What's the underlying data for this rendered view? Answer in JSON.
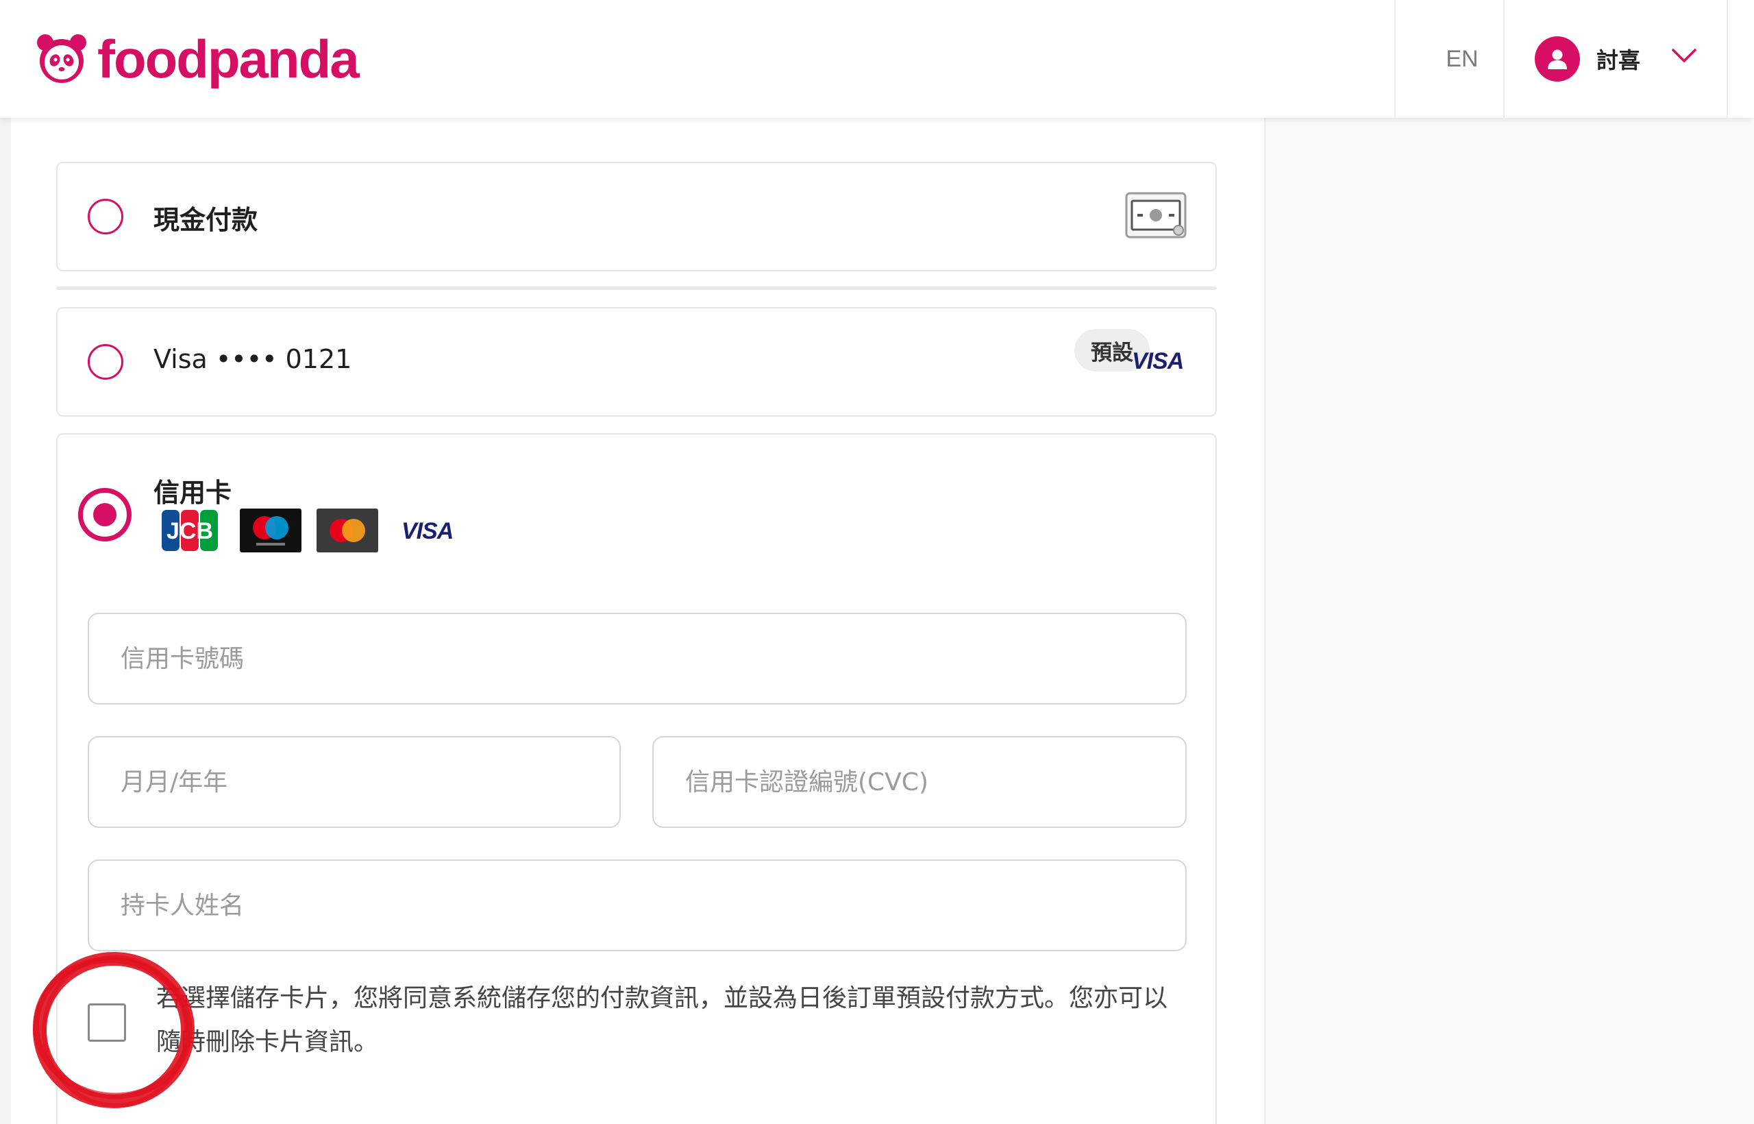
{
  "header": {
    "brand": "foodpanda",
    "lang": "EN",
    "user_name": "討喜"
  },
  "payment": {
    "cash": {
      "label": "現金付款"
    },
    "saved_card": {
      "label": "Visa •••• 0121",
      "badge": "預設",
      "brand_text": "VISA"
    },
    "credit_card": {
      "label": "信用卡",
      "logos": [
        "JCB",
        "maestro",
        "mastercard",
        "VISA"
      ],
      "card_number_placeholder": "信用卡號碼",
      "expiry_placeholder": "月月/年年",
      "cvc_placeholder": "信用卡認證編號(CVC)",
      "holder_placeholder": "持卡人姓名",
      "consent_text": "若選擇儲存卡片，您將同意系統儲存您的付款資訊，並設為日後訂單預設付款方式。您亦可以隨時刪除卡片資訊。"
    }
  },
  "colors": {
    "brand": "#d70f64",
    "annotation": "#e0101e"
  }
}
